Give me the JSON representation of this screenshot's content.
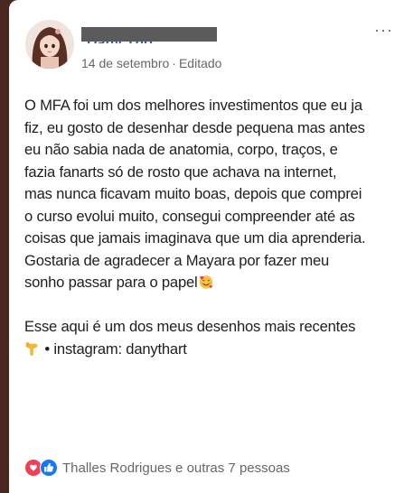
{
  "post": {
    "author_name": "Dany Tho",
    "date": "14 de setembro",
    "separator": "·",
    "edited": "Editado",
    "more_label": "···",
    "lines": [
      "O MFA foi um dos melhores investimentos que eu ja",
      "fiz, eu gosto de desenhar desde pequena mas antes",
      "eu não sabia nada de anatomia, corpo, traços, e",
      "fazia fanarts só de rosto que achava na internet,",
      "mas nunca ficavam muito boas, depois que comprei",
      "o curso evolui muito, consegui compreender até as",
      "coisas que jamais imaginava que um dia aprenderia.",
      "Gostaria de agradecer a Mayara por fazer meu",
      "sonho passar para o papel"
    ],
    "emoji_after_paragraph": "smiling-face-with-hearts",
    "second_paragraph_line1": "Esse aqui é um dos meus desenhos mais recentes",
    "second_paragraph_line2": " • instagram: danythart",
    "pointing_emoji": "backhand-index-pointing-down"
  },
  "reactions": {
    "icons": [
      "love-reaction-icon",
      "like-reaction-icon"
    ],
    "text": "Thalles Rodrigues e outras 7 pessoas"
  },
  "colors": {
    "background": "#4a2620",
    "card": "#ffffff",
    "text": "#1c1e21",
    "meta_text": "#65676b",
    "love_red": "#f33e58",
    "like_blue": "#1877f2"
  }
}
